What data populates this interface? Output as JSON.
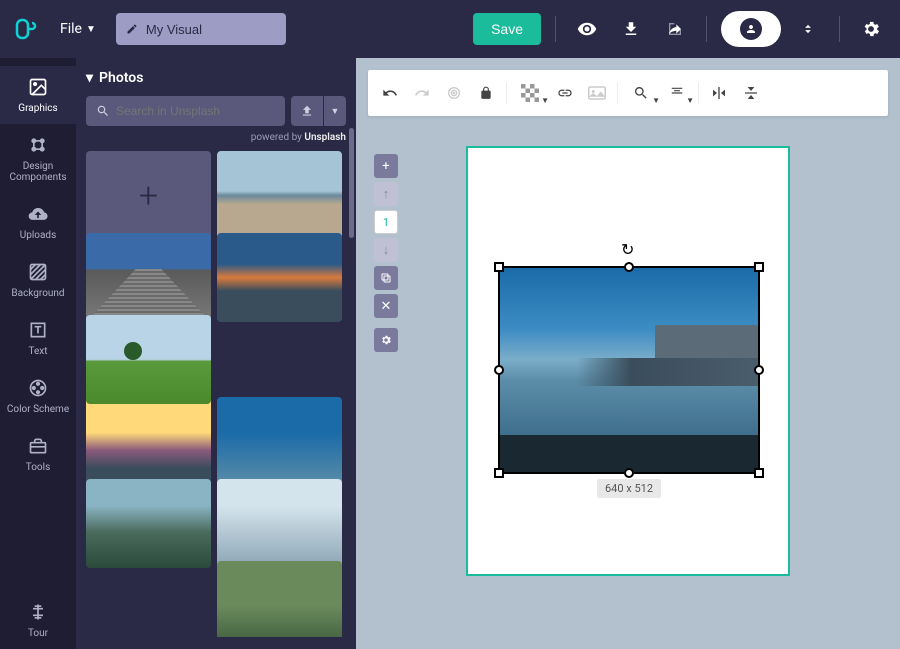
{
  "topbar": {
    "file_label": "File",
    "title_value": "My Visual",
    "save_label": "Save"
  },
  "sidebar": {
    "items": [
      {
        "label": "Graphics",
        "icon": "image-icon"
      },
      {
        "label": "Design Components",
        "icon": "components-icon"
      },
      {
        "label": "Uploads",
        "icon": "cloud-upload-icon"
      },
      {
        "label": "Background",
        "icon": "texture-icon"
      },
      {
        "label": "Text",
        "icon": "text-icon"
      },
      {
        "label": "Color Scheme",
        "icon": "palette-icon"
      },
      {
        "label": "Tools",
        "icon": "toolbox-icon"
      }
    ],
    "tour_label": "Tour"
  },
  "panel": {
    "title": "Photos",
    "search_placeholder": "Search in Unsplash",
    "powered_prefix": "powered by ",
    "powered_brand": "Unsplash"
  },
  "page_tools": {
    "page_number": "1"
  },
  "selection": {
    "dimensions": "640 x 512"
  }
}
